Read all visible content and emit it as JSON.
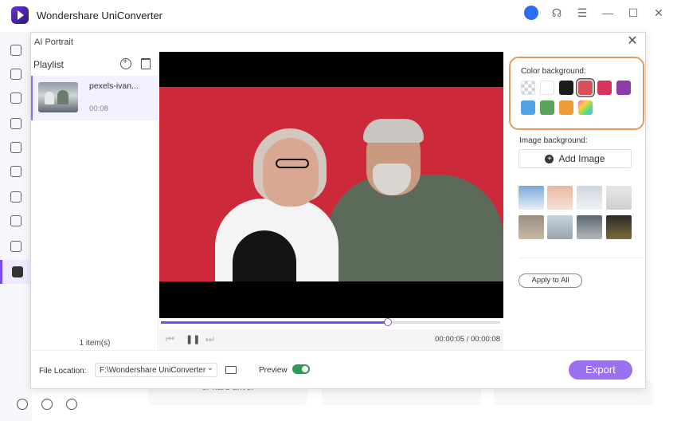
{
  "app": {
    "title": "Wondershare UniConverter"
  },
  "dialog": {
    "title": "AI Portrait",
    "close_symbol": "✕"
  },
  "playlist": {
    "title": "Playlist",
    "items": [
      {
        "name": "pexels-ivan...",
        "duration": "00:08"
      }
    ],
    "count": "1 item(s)"
  },
  "player": {
    "time": "00:00:05 / 00:00:08",
    "progress_fraction": 0.67,
    "prev_symbol": "⏮",
    "pause_symbol": "❚❚",
    "next_symbol": "⏭"
  },
  "panel": {
    "color_bg_label": "Color background:",
    "image_bg_label": "Image background:",
    "add_image_label": "Add Image",
    "apply_all_label": "Apply to All",
    "swatches": [
      "transparent",
      "#ffffff",
      "#1b1b1b",
      "#d9505a",
      "#d8335c",
      "#8e3aa8",
      "#4fa4e8",
      "#59a35b",
      "#ee9a35",
      "gradient"
    ],
    "selected_swatch_index": 3
  },
  "bottom": {
    "file_location_label": "File Location:",
    "file_location_value": "F:\\Wondershare UniConverter",
    "preview_label": "Preview",
    "preview_on": true,
    "export_label": "Export"
  },
  "underlying": {
    "card_texts": [
      "or hard drive.",
      "",
      ""
    ]
  },
  "colors": {
    "accent": "#7a4de8",
    "export": "#9a72f0",
    "highlight_border": "#e69a5a",
    "video_bg": "#cc2a3a",
    "toggle_on": "#2e9a58"
  }
}
